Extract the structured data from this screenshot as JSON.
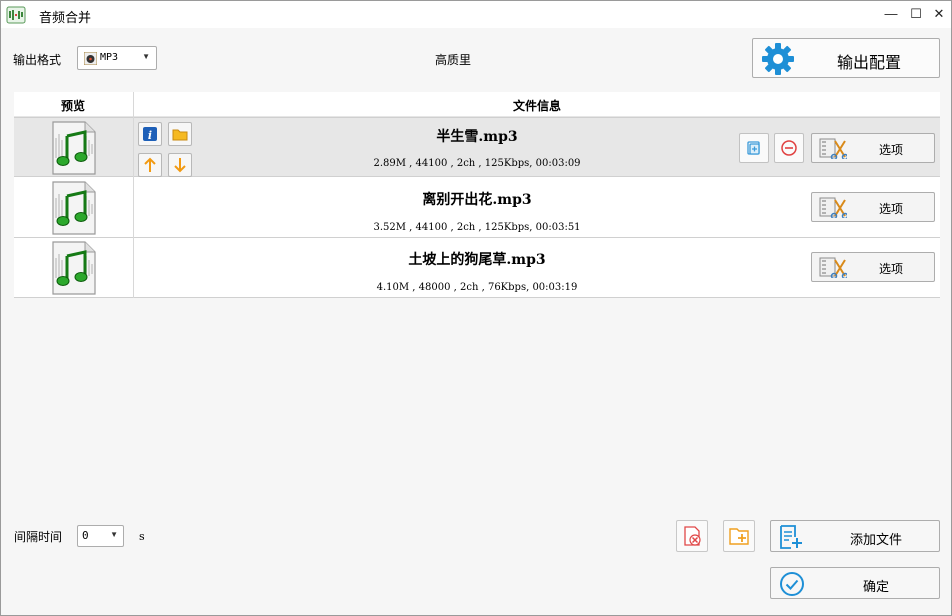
{
  "window": {
    "title": "音频合并"
  },
  "top": {
    "format_label": "输出格式",
    "format_value": "MP3",
    "quality": "高质里",
    "config_button": "输出配置"
  },
  "table": {
    "headers": {
      "preview": "预览",
      "info": "文件信息"
    },
    "rows": [
      {
        "name": "半生雪.mp3",
        "info": "2.89M , 44100 , 2ch , 125Kbps, 00:03:09",
        "option": "选项",
        "selected": true
      },
      {
        "name": "离别开出花.mp3",
        "info": "3.52M , 44100 , 2ch , 125Kbps, 00:03:51",
        "option": "选项",
        "selected": false
      },
      {
        "name": "土坡上的狗尾草.mp3",
        "info": "4.10M , 48000 , 2ch , 76Kbps, 00:03:19",
        "option": "选项",
        "selected": false
      }
    ]
  },
  "bottom": {
    "interval_label": "间隔时间",
    "interval_value": "0",
    "interval_unit": "s",
    "add_button": "添加文件",
    "ok_button": "确定"
  },
  "icons": {
    "app": "audio-merge-icon",
    "gear": "gear-icon",
    "music_file": "music-file-icon",
    "info": "info-icon",
    "folder": "folder-icon",
    "up": "arrow-up-icon",
    "down": "arrow-down-icon",
    "copy": "copy-icon",
    "remove": "remove-icon",
    "edit": "edit-clip-icon",
    "clear": "clear-list-icon",
    "open_folder": "open-folder-icon",
    "add_file": "add-file-icon",
    "confirm": "confirm-check-icon"
  },
  "colors": {
    "accent_blue": "#1e8fd6",
    "orange": "#f0a020",
    "red": "#e04040",
    "selected_row": "#e7e7e7"
  }
}
